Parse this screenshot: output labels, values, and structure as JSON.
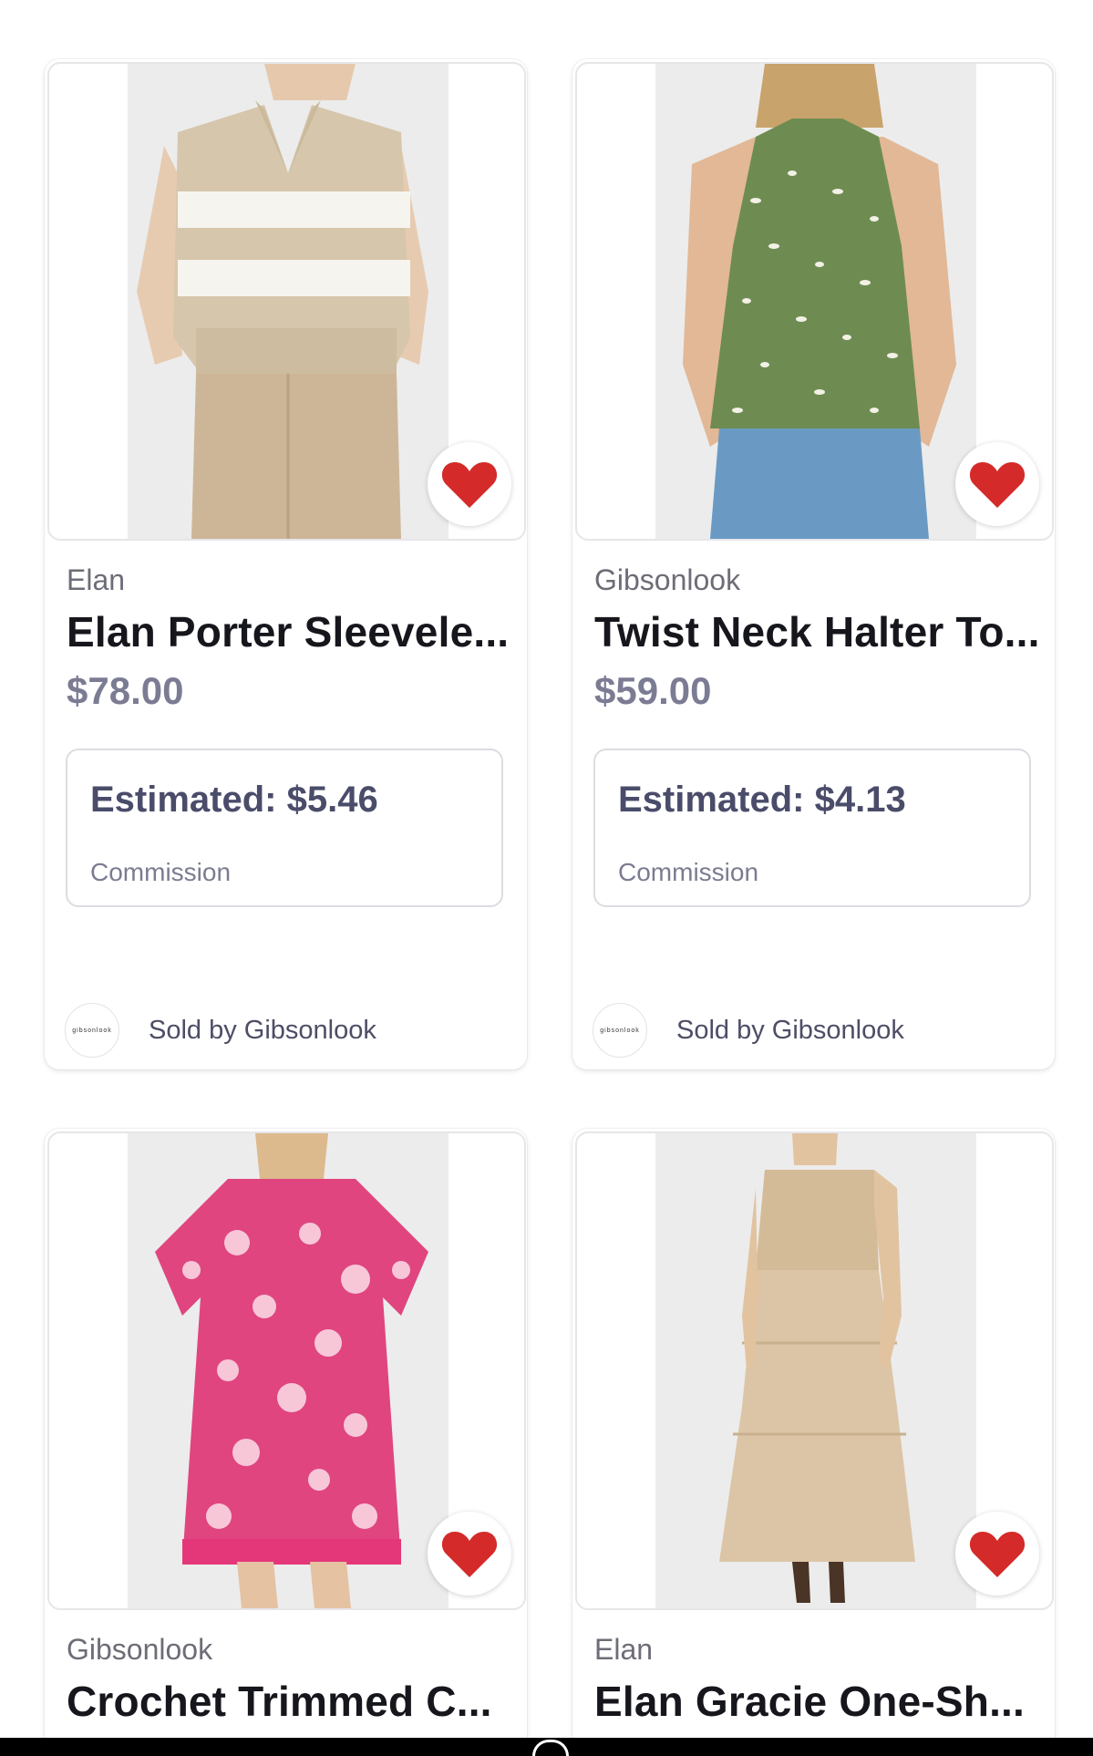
{
  "products": [
    {
      "brand": "Elan",
      "title": "Elan Porter Sleevele...",
      "price": "$78.00",
      "estimate": "Estimated: $5.46",
      "estimate_label": "Commission",
      "seller": "Sold by Gibsonlook",
      "seller_logo_text": "gibsonlook",
      "favorited": true
    },
    {
      "brand": "Gibsonlook",
      "title": "Twist Neck Halter To...",
      "price": "$59.00",
      "estimate": "Estimated: $4.13",
      "estimate_label": "Commission",
      "seller": "Sold by Gibsonlook",
      "seller_logo_text": "gibsonlook",
      "favorited": true
    },
    {
      "brand": "Gibsonlook",
      "title": "Crochet Trimmed C...",
      "favorited": true
    },
    {
      "brand": "Elan",
      "title": "Elan Gracie One-Sh...",
      "favorited": true
    }
  ],
  "colors": {
    "heart": "#d42a2a",
    "price": "#7b7c94",
    "estimate": "#4a4c6a"
  }
}
